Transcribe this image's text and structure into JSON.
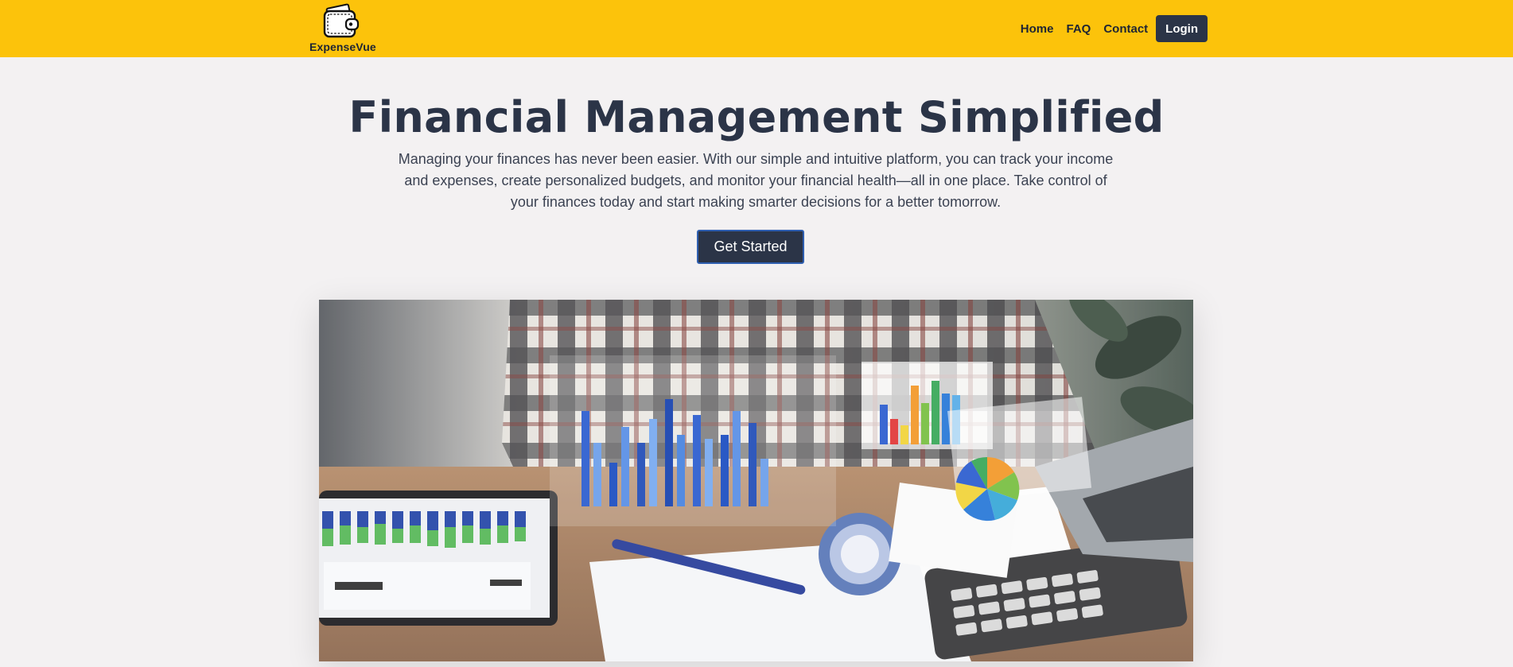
{
  "header": {
    "brand_name": "ExpenseVue",
    "brand_icon": "wallet-icon",
    "nav": [
      {
        "label": "Home"
      },
      {
        "label": "FAQ"
      },
      {
        "label": "Contact"
      }
    ],
    "login_label": "Login",
    "background_color": "#fcc30b"
  },
  "hero": {
    "title": "Financial Management Simplified",
    "description": "Managing your finances has never been easier. With our simple and intuitive platform, you can track your income and expenses, create personalized budgets, and monitor your financial health—all in one place. Take control of your finances today and start making smarter decisions for a better tomorrow.",
    "cta_label": "Get Started",
    "image_subject": "person-analyzing-financial-charts-photo"
  },
  "colors": {
    "page_background": "#f3f1f2",
    "primary_dark": "#2b3447",
    "accent_yellow": "#fcc30b"
  }
}
